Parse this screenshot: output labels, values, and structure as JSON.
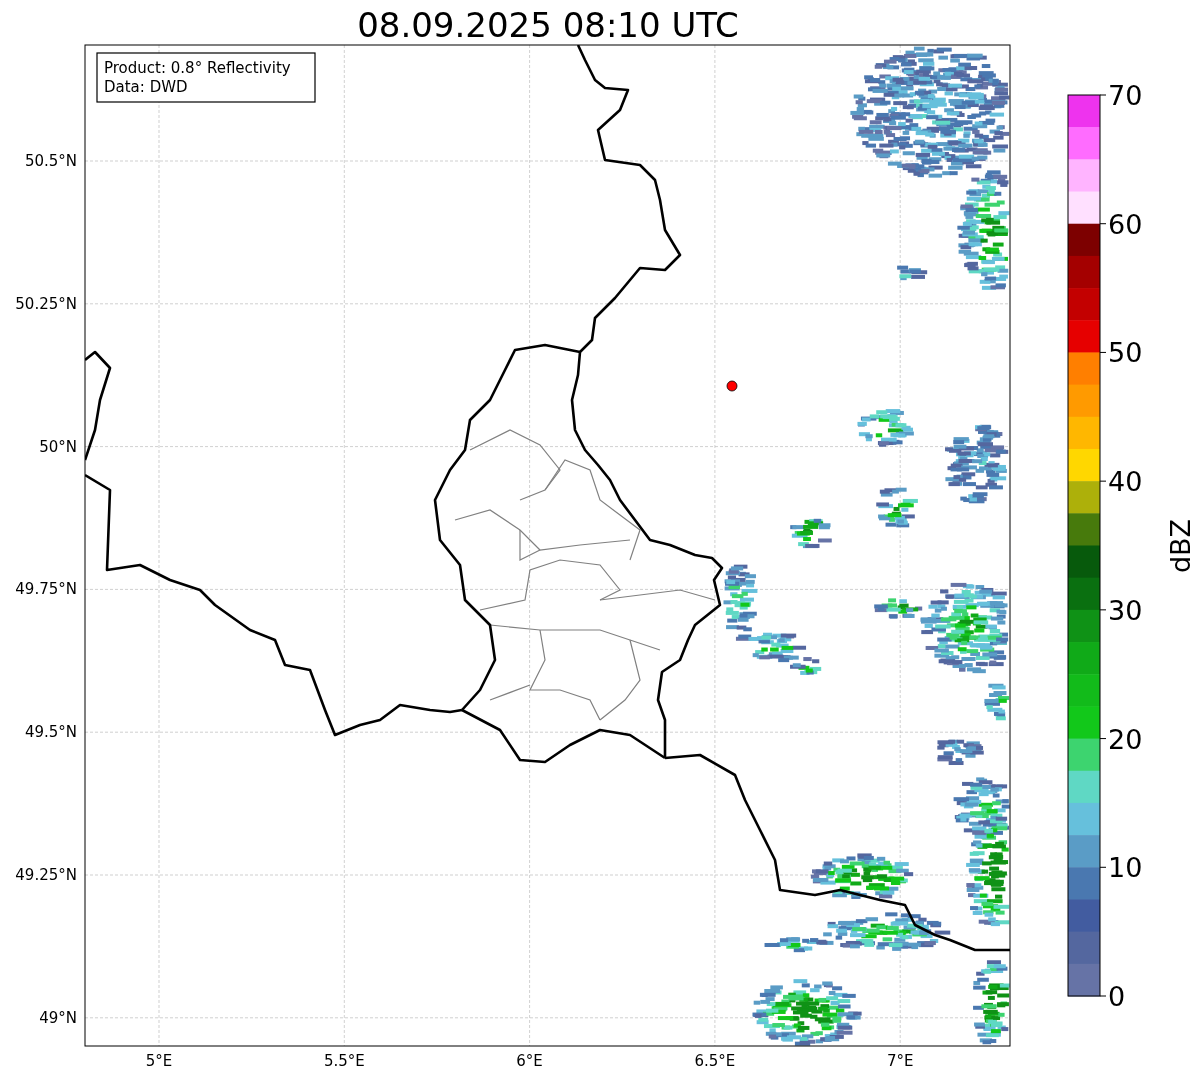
{
  "title": "08.09.2025 08:10 UTC",
  "info_box": [
    "Product: 0.8° Reflectivity",
    "Data: DWD"
  ],
  "latitude_labels": [
    "50.5°N",
    "50.25°N",
    "50°N",
    "49.75°N",
    "49.5°N",
    "49.25°N",
    "49°N"
  ],
  "longitude_labels": [
    "5°E",
    "5.5°E",
    "6°E",
    "6.5°E",
    "7°E"
  ],
  "colorbar": {
    "label": "dBZ",
    "ticks": [
      "70",
      "60",
      "50",
      "40",
      "30",
      "20",
      "10",
      "0"
    ],
    "bands": [
      {
        "color": "#ee33ee"
      },
      {
        "color": "#ff6cff"
      },
      {
        "color": "#ffb4ff"
      },
      {
        "color": "#ffe0ff"
      },
      {
        "color": "#7d0000"
      },
      {
        "color": "#a40000"
      },
      {
        "color": "#c30000"
      },
      {
        "color": "#e60000"
      },
      {
        "color": "#ff7f00"
      },
      {
        "color": "#ff9a00"
      },
      {
        "color": "#ffb700"
      },
      {
        "color": "#ffd700"
      },
      {
        "color": "#adb00a"
      },
      {
        "color": "#477a0c"
      },
      {
        "color": "#075a0c"
      },
      {
        "color": "#0a7010"
      },
      {
        "color": "#0f9216"
      },
      {
        "color": "#10aa18"
      },
      {
        "color": "#12bb1a"
      },
      {
        "color": "#12c81a"
      },
      {
        "color": "#3dd46f"
      },
      {
        "color": "#5fd8c4"
      },
      {
        "color": "#66c0dc"
      },
      {
        "color": "#5a9cc6"
      },
      {
        "color": "#4a78b0"
      },
      {
        "color": "#425ca0"
      },
      {
        "color": "#54679f"
      },
      {
        "color": "#6673a6"
      }
    ]
  }
}
